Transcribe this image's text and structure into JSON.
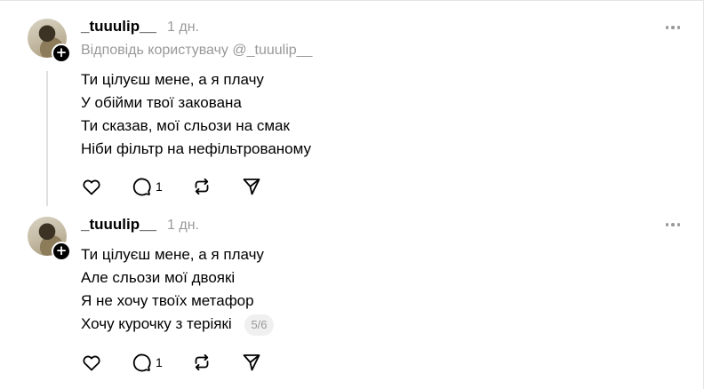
{
  "posts": [
    {
      "username": "_tuuulip__",
      "time": "1 дн.",
      "reply_to": "Відповідь користувачу @_tuuulip__",
      "lines": [
        "Ти цілуєш мене, а я плачу",
        "У обійми твої закована",
        "Ти сказав, мої сльози на смак",
        "Ніби фільтр на нефільтрованому"
      ],
      "reply_count": "1",
      "follow_symbol": "+"
    },
    {
      "username": "_tuuulip__",
      "time": "1 дн.",
      "lines": [
        "Ти цілуєш мене, а я плачу",
        "Але сльози мої двоякі",
        "Я не хочу твоїх метафор",
        "Хочу курочку з теріякі"
      ],
      "page_counter": "5/6",
      "reply_count": "1",
      "follow_symbol": "+"
    }
  ],
  "icons": {
    "like": "heart-icon",
    "reply": "comment-bubble-icon",
    "repost": "repost-icon",
    "share": "send-icon",
    "more": "more-horizontal-icon"
  },
  "colors": {
    "text": "#000000",
    "muted": "#999999",
    "thread_line": "#e0e0e0",
    "badge": "#000000"
  }
}
